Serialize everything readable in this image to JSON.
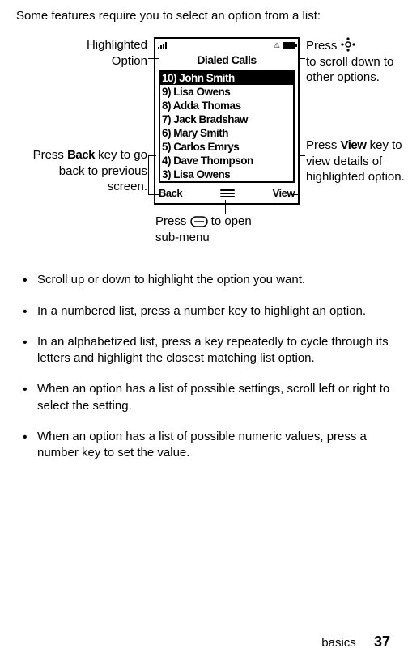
{
  "intro": "Some features require you to select an option from a list:",
  "phone": {
    "title": "Dialed Calls",
    "rows": [
      "10) John Smith",
      "9) Lisa Owens",
      "8) Adda Thomas",
      "7) Jack Bradshaw",
      "6) Mary Smith",
      "5) Carlos Emrys",
      "4) Dave Thompson",
      "3) Lisa Owens"
    ],
    "soft_left": "Back",
    "soft_right": "View"
  },
  "annotations": {
    "highlighted": "Highlighted\nOption",
    "scroll_a": "Press ",
    "scroll_b": "to scroll down to other options.",
    "back_a": "Press ",
    "back_key": "Back",
    "back_b": " key to go back to previous screen.",
    "view_a": "Press ",
    "view_key": "View",
    "view_b": " key to view details of highlighted option.",
    "menu_a": "Press ",
    "menu_b": " to open sub-menu"
  },
  "bullets": [
    "Scroll up or down to highlight the option you want.",
    "In a numbered list, press a number key to highlight an option.",
    "In an alphabetized list, press a key repeatedly to cycle through its letters and highlight the closest matching list option.",
    "When an option has a list of possible settings, scroll left or right to select the setting.",
    "When an option has a list of possible numeric values, press a number key to set the value."
  ],
  "footer": {
    "section": "basics",
    "page": "37"
  }
}
